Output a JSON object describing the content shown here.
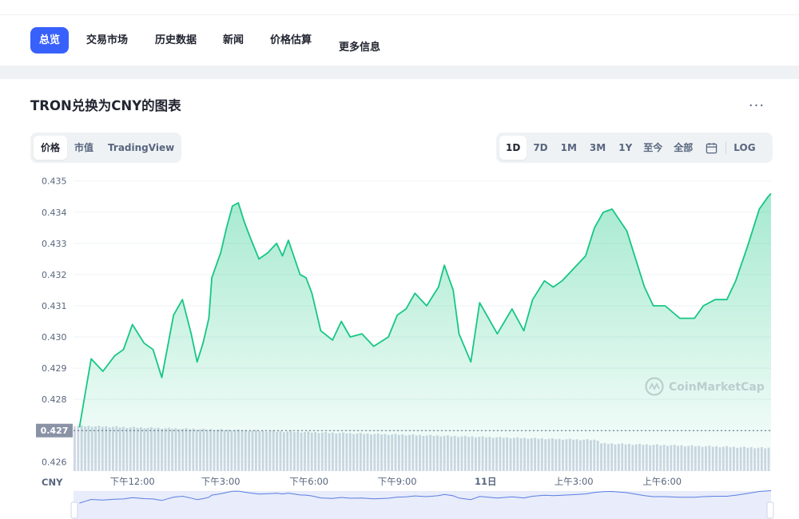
{
  "nav": {
    "items": [
      {
        "label": "总览",
        "active": true
      },
      {
        "label": "交易市场",
        "active": false
      },
      {
        "label": "历史数据",
        "active": false
      },
      {
        "label": "新闻",
        "active": false
      },
      {
        "label": "价格估算",
        "active": false
      },
      {
        "label": "更多信息",
        "active": false
      }
    ]
  },
  "chart_header": {
    "title": "TRON兑换为CNY的图表",
    "more_label": "···"
  },
  "view_tabs": [
    {
      "label": "价格",
      "active": true
    },
    {
      "label": "市值",
      "active": false
    },
    {
      "label": "TradingView",
      "active": false
    }
  ],
  "range_tabs": [
    {
      "label": "1D",
      "active": true
    },
    {
      "label": "7D",
      "active": false
    },
    {
      "label": "1M",
      "active": false
    },
    {
      "label": "3M",
      "active": false
    },
    {
      "label": "1Y",
      "active": false
    },
    {
      "label": "至今",
      "active": false
    },
    {
      "label": "全部",
      "active": false
    }
  ],
  "calendar_icon": "calendar-icon",
  "log_label": "LOG",
  "colors": {
    "accent": "#3861fb",
    "line": "#16c784",
    "volume": "#cfd6e4",
    "nav_bar": "#5b7ee0"
  },
  "chart_data": {
    "type": "area",
    "currency_label": "CNY",
    "current_price_label": "0.427",
    "watermark": "CoinMarketCap",
    "y_ticks": [
      "0.435",
      "0.434",
      "0.433",
      "0.432",
      "0.431",
      "0.430",
      "0.429",
      "0.428",
      "0.427",
      "0.426"
    ],
    "x_ticks": [
      "下午12:00",
      "下午3:00",
      "下午6:00",
      "下午9:00",
      "11日",
      "上午3:00",
      "上午6:00"
    ],
    "x_ticks_bold": [
      false,
      false,
      false,
      false,
      true,
      false,
      false
    ],
    "ylim": [
      0.4257,
      0.4353
    ],
    "x_hours": [
      10.2,
      10.4,
      10.6,
      11.0,
      11.4,
      11.7,
      12.0,
      12.4,
      12.7,
      13.0,
      13.2,
      13.4,
      13.7,
      14.0,
      14.2,
      14.4,
      14.6,
      14.7,
      15.0,
      15.2,
      15.4,
      15.6,
      15.8,
      16.0,
      16.3,
      16.6,
      16.9,
      17.1,
      17.3,
      17.7,
      17.9,
      18.1,
      18.4,
      18.8,
      19.1,
      19.4,
      19.8,
      20.2,
      20.7,
      21.0,
      21.3,
      21.6,
      22.0,
      22.4,
      22.6,
      22.9,
      23.1,
      23.5,
      23.8,
      24.1,
      24.4,
      24.9,
      25.3,
      25.6,
      26.0,
      26.3,
      26.6,
      27.0,
      27.4,
      27.7,
      28.0,
      28.3,
      28.8,
      29.4,
      29.7,
      30.1,
      30.6,
      31.1,
      31.4,
      31.8,
      32.2,
      32.5,
      32.9,
      33.3,
      33.6,
      33.7
    ],
    "values": [
      0.4271,
      0.4282,
      0.4293,
      0.4289,
      0.4294,
      0.4296,
      0.4304,
      0.4298,
      0.4296,
      0.4287,
      0.4297,
      0.4307,
      0.4312,
      0.4301,
      0.4292,
      0.4298,
      0.4306,
      0.4319,
      0.4327,
      0.4335,
      0.4342,
      0.4343,
      0.4337,
      0.4332,
      0.4325,
      0.4327,
      0.433,
      0.4326,
      0.4331,
      0.432,
      0.4319,
      0.4314,
      0.4302,
      0.4299,
      0.4305,
      0.43,
      0.4301,
      0.4297,
      0.43,
      0.4307,
      0.4309,
      0.4314,
      0.431,
      0.4316,
      0.4323,
      0.4315,
      0.4301,
      0.4292,
      0.4311,
      0.4306,
      0.4301,
      0.4309,
      0.4302,
      0.4312,
      0.4318,
      0.4316,
      0.4318,
      0.4322,
      0.4326,
      0.4335,
      0.434,
      0.4341,
      0.4334,
      0.4316,
      0.431,
      0.431,
      0.4306,
      0.4306,
      0.431,
      0.4312,
      0.4312,
      0.4318,
      0.4329,
      0.4341,
      0.4345,
      0.4346
    ]
  }
}
